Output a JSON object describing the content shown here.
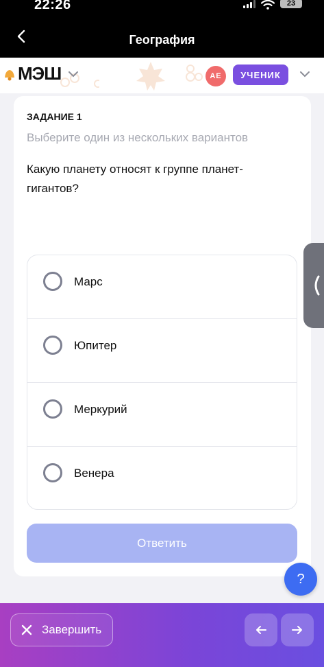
{
  "status_bar": {
    "time": "22:26",
    "battery": "23"
  },
  "nav": {
    "title": "География"
  },
  "header": {
    "logo_text": "МЭШ",
    "avatar_initials": "АЕ",
    "role": "УЧЕНИК"
  },
  "task": {
    "label": "ЗАДАНИЕ 1",
    "hint": "Выберите один из нескольких вариантов",
    "question": "Какую планету относят к группе планет-гигантов?",
    "options": [
      {
        "label": "Марс",
        "selected": false
      },
      {
        "label": "Юпитер",
        "selected": false
      },
      {
        "label": "Меркурий",
        "selected": false
      },
      {
        "label": "Венера",
        "selected": false
      }
    ],
    "submit_label": "Ответить"
  },
  "help": {
    "label": "?"
  },
  "footer": {
    "finish_label": "Завершить"
  },
  "icons": {
    "back": "chevron-left-icon",
    "logo": "bell-icon",
    "dropdown": "chevron-down-icon",
    "side_tab": "chevron-left-icon",
    "finish": "close-icon",
    "prev": "arrow-left-icon",
    "next": "arrow-right-icon"
  },
  "colors": {
    "accent": "#7a4fe0",
    "submit_disabled": "#a8b4f3",
    "help": "#3d6cf2",
    "avatar": "#f06b6b"
  }
}
